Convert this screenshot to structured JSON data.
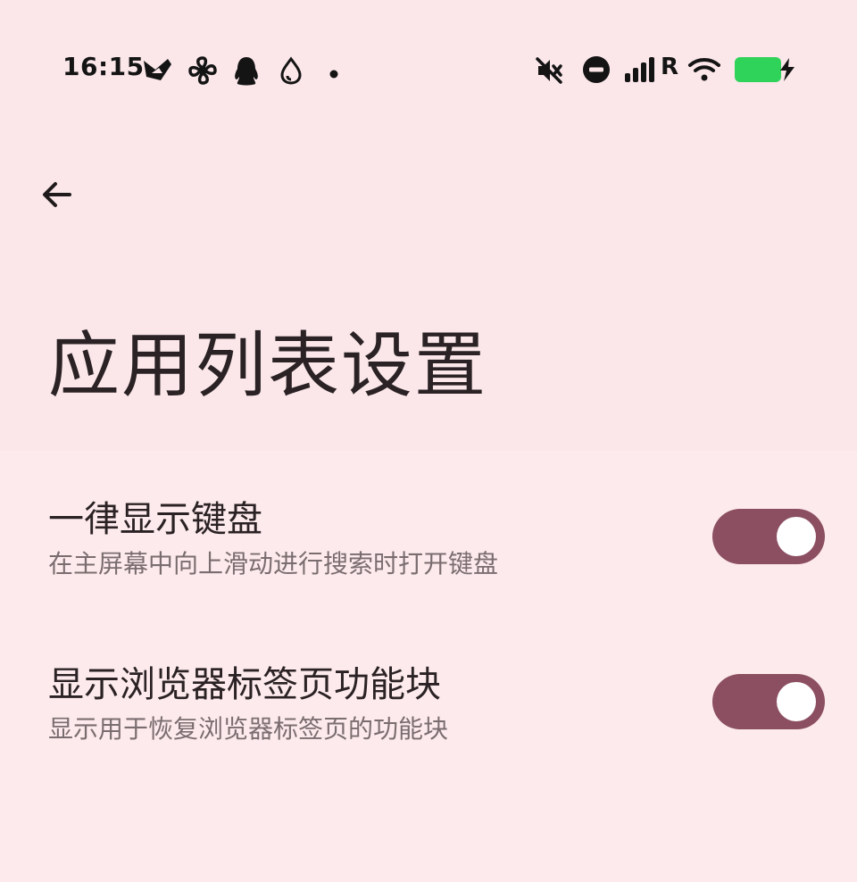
{
  "status_bar": {
    "time": "16:15",
    "network_label": "R",
    "notification_icons": [
      "bird-app-icon",
      "pinwheel-icon",
      "qq-penguin-icon",
      "water-drop-icon",
      "more-dot-icon"
    ],
    "system_icons": [
      "mute-icon",
      "do-not-disturb-icon",
      "signal-icon",
      "wifi-icon",
      "battery-charging-icon"
    ],
    "battery_color": "#2fd35a"
  },
  "header": {
    "back_icon": "arrow-left-icon",
    "title": "应用列表设置"
  },
  "settings": [
    {
      "title": "一律显示键盘",
      "description": "在主屏幕中向上滑动进行搜索时打开键盘",
      "enabled": true
    },
    {
      "title": "显示浏览器标签页功能块",
      "description": "显示用于恢复浏览器标签页的功能块",
      "enabled": true
    }
  ],
  "colors": {
    "background": "#fdeaec",
    "toggle_on": "#8b4f61",
    "title_text": "#2a2224",
    "secondary_text": "#7a6d70"
  }
}
